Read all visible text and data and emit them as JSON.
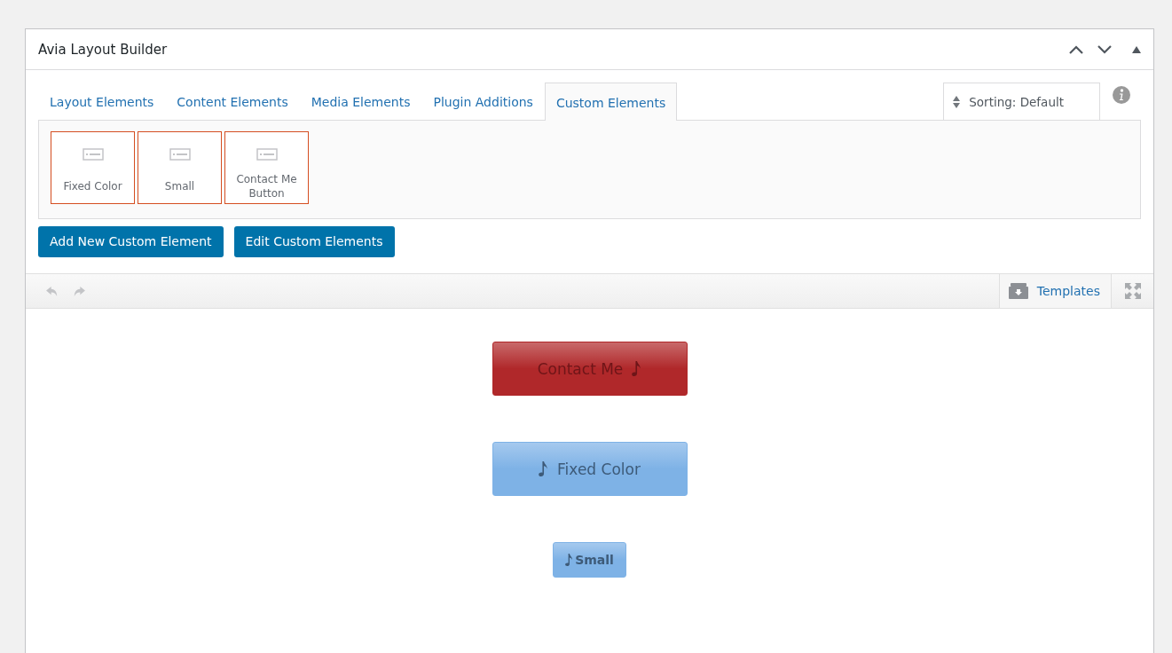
{
  "panel": {
    "title": "Avia Layout Builder"
  },
  "tabs": [
    {
      "label": "Layout Elements",
      "selected": false
    },
    {
      "label": "Content Elements",
      "selected": false
    },
    {
      "label": "Media Elements",
      "selected": false
    },
    {
      "label": "Plugin Additions",
      "selected": false
    },
    {
      "label": "Custom Elements",
      "selected": true
    }
  ],
  "sorting": {
    "label": "Sorting: Default"
  },
  "elements": [
    {
      "label": "Fixed Color"
    },
    {
      "label": "Small"
    },
    {
      "label": "Contact Me Button"
    }
  ],
  "actions": [
    "Add New Custom Element",
    "Edit Custom Elements"
  ],
  "toolbar": {
    "templates": "Templates"
  },
  "preview": [
    {
      "label": "Contact Me",
      "color": "#b0282a",
      "kind": "trailing"
    },
    {
      "label": "Fixed Color",
      "color": "#7eb2e6",
      "kind": "leading"
    },
    {
      "label": "Small",
      "color": "#7eb2e6",
      "kind": "small"
    }
  ]
}
